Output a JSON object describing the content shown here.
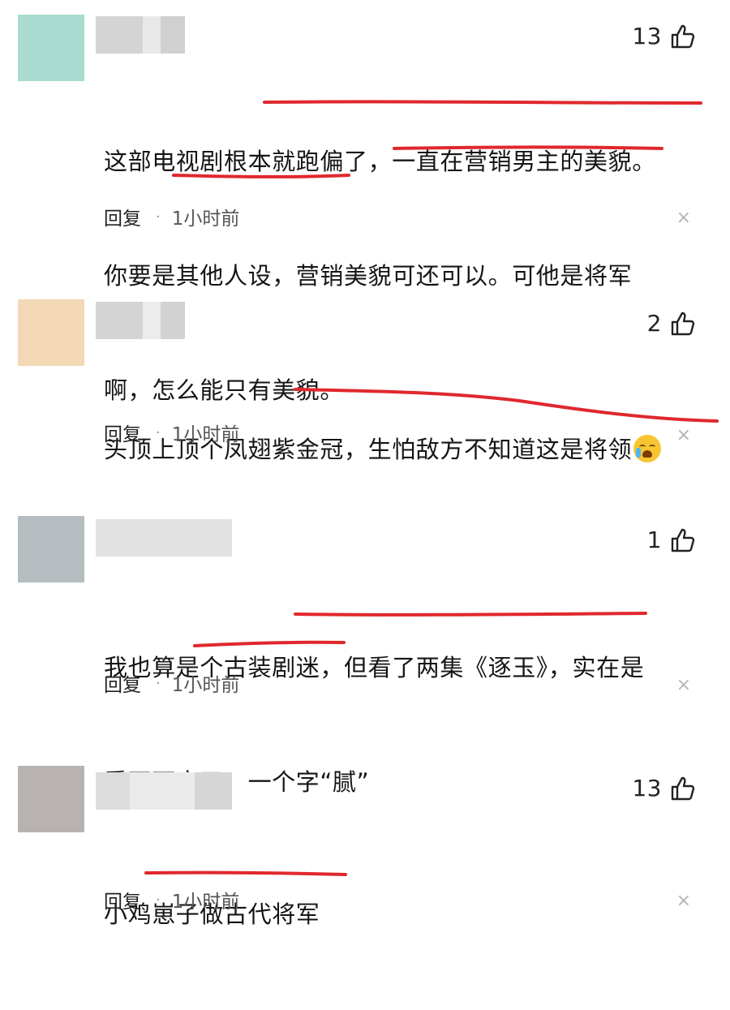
{
  "comments": [
    {
      "likes": "13",
      "lines": [
        "这部电视剧根本就跑偏了，一直在营销男主的美貌。",
        "你要是其他人设，营销美貌可还可以。可他是将军",
        "啊，怎么能只有美貌。"
      ],
      "reply": "回复",
      "time": "1小时前",
      "avatar_color": "#a9dbd0"
    },
    {
      "likes": "2",
      "lines": [
        "头顶上顶个凤翅紫金冠，生怕敌方不知道这是将领"
      ],
      "emoji": "crying-face",
      "reply": "回复",
      "time": "1小时前",
      "avatar_color": "#f2d8b4"
    },
    {
      "likes": "1",
      "lines": [
        "我也算是个古装剧迷，但看了两集《逐玉》，实在是",
        "看不下去了。一个字“腻”"
      ],
      "reply": "回复",
      "time": "1小时前",
      "avatar_color": "#b6bdc1"
    },
    {
      "likes": "13",
      "lines": [
        "小鸡崽子做古代将军"
      ],
      "reply": "回复",
      "time": "1小时前",
      "avatar_color": "#b8b3b1"
    }
  ],
  "close_glyph": "×",
  "annotation_color": "#e0282d"
}
